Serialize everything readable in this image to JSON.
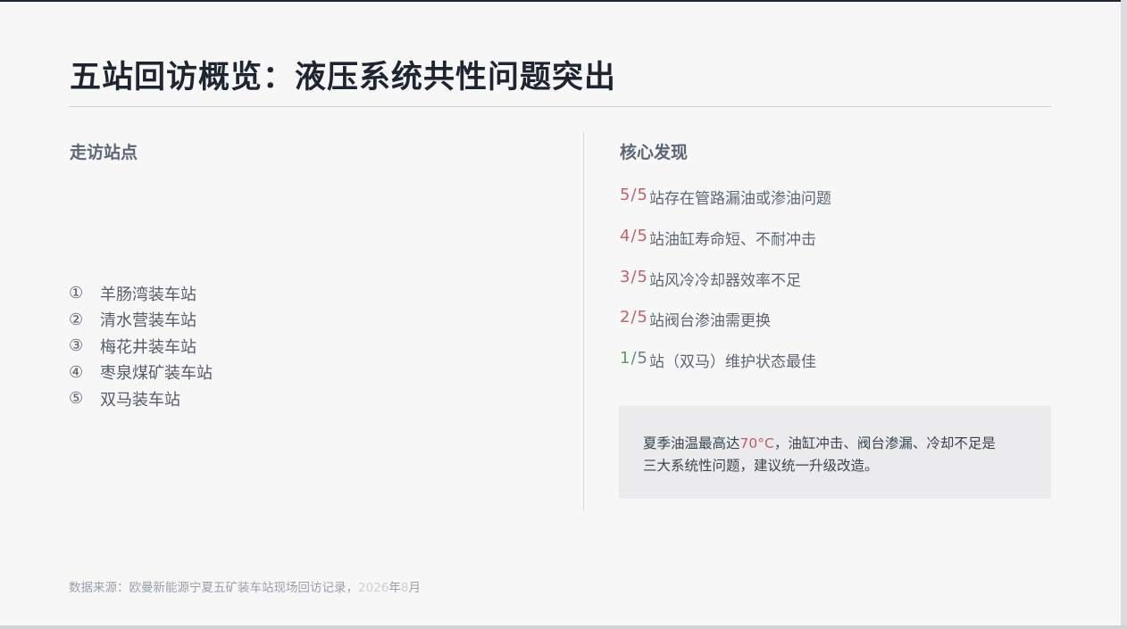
{
  "slide": {
    "title": "五站回访概览：液压系统共性问题突出",
    "left_heading": "走访站点",
    "right_heading": "核心发现",
    "stations": [
      {
        "num": "①",
        "name": "羊肠湾装车站"
      },
      {
        "num": "②",
        "name": "清水营装车站"
      },
      {
        "num": "③",
        "name": "梅花井装车站"
      },
      {
        "num": "④",
        "name": "枣泉煤矿装车站"
      },
      {
        "num": "⑤",
        "name": "双马装车站"
      }
    ],
    "findings": [
      {
        "count": "5",
        "slash": "/",
        "total": "5",
        "text": "站存在管路漏油或渗油问题",
        "status": "issue"
      },
      {
        "count": "4",
        "slash": "/",
        "total": "5",
        "text": "站油缸寿命短、不耐冲击",
        "status": "issue"
      },
      {
        "count": "3",
        "slash": "/",
        "total": "5",
        "text": "站风冷冷却器效率不足",
        "status": "issue"
      },
      {
        "count": "2",
        "slash": "/",
        "total": "5",
        "text": "站阀台渗油需更换",
        "status": "issue"
      },
      {
        "count": "1",
        "slash": "/",
        "total": "5",
        "text": "站（双马）维护状态最佳",
        "status": "good"
      }
    ],
    "callout": {
      "line1_prefix": "夏季油温最高达",
      "temperature": "70°C",
      "line1_suffix": "，油缸冲击、阀台渗漏、冷却不足是",
      "line2": "三大系统性问题，建议统一升级改造。"
    },
    "source": {
      "prefix": "数据来源：欧曼新能源宁夏五矿装车站现场回访记录，",
      "year": "2026",
      "year_unit": "年",
      "month": "8",
      "month_unit": "月"
    }
  },
  "colors": {
    "title": "#1e2430",
    "accent_issue": "#c0636b",
    "accent_good": "#5a9a6c",
    "callout_bg": "#ebebed",
    "top_bar": "#1f2633"
  }
}
